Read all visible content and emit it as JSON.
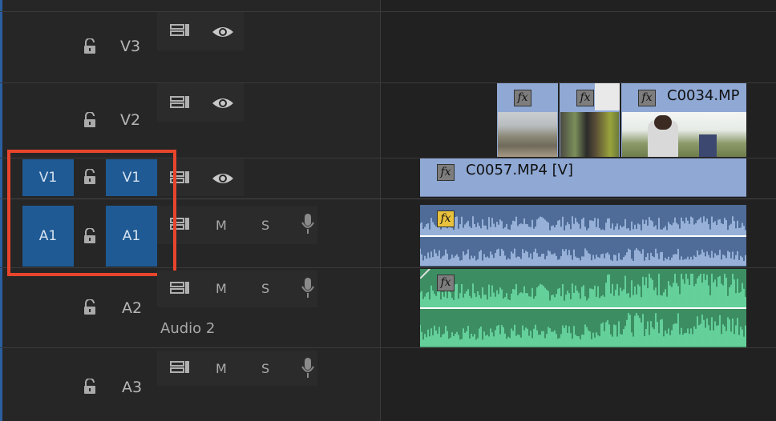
{
  "tracks": {
    "v3": {
      "label": "V3"
    },
    "v2": {
      "label": "V2"
    },
    "v1": {
      "label": "V1",
      "source_patch": "V1",
      "target": "V1"
    },
    "a1": {
      "label": "A1",
      "source_patch": "A1",
      "target": "A1",
      "mute": "M",
      "solo": "S"
    },
    "a2": {
      "label": "A2",
      "name": "Audio 2",
      "mute": "M",
      "solo": "S"
    },
    "a3": {
      "label": "A3",
      "mute": "M",
      "solo": "S"
    }
  },
  "clips": {
    "v2_a": {
      "fx": "fx"
    },
    "v2_b": {
      "fx": "fx"
    },
    "v2_c": {
      "name": "C0034.MP",
      "fx": "fx"
    },
    "v1_main": {
      "name": "C0057.MP4 [V]",
      "fx": "fx"
    },
    "a1_main": {
      "fx": "fx"
    },
    "a2_main": {
      "fx": "fx"
    }
  },
  "colors": {
    "video_clip": "#8fa8d4",
    "audio_a1": "#5d7ba8",
    "audio_a2": "#52c48c",
    "highlight_box": "#e8452c",
    "patch_blue": "#1f5a94"
  }
}
